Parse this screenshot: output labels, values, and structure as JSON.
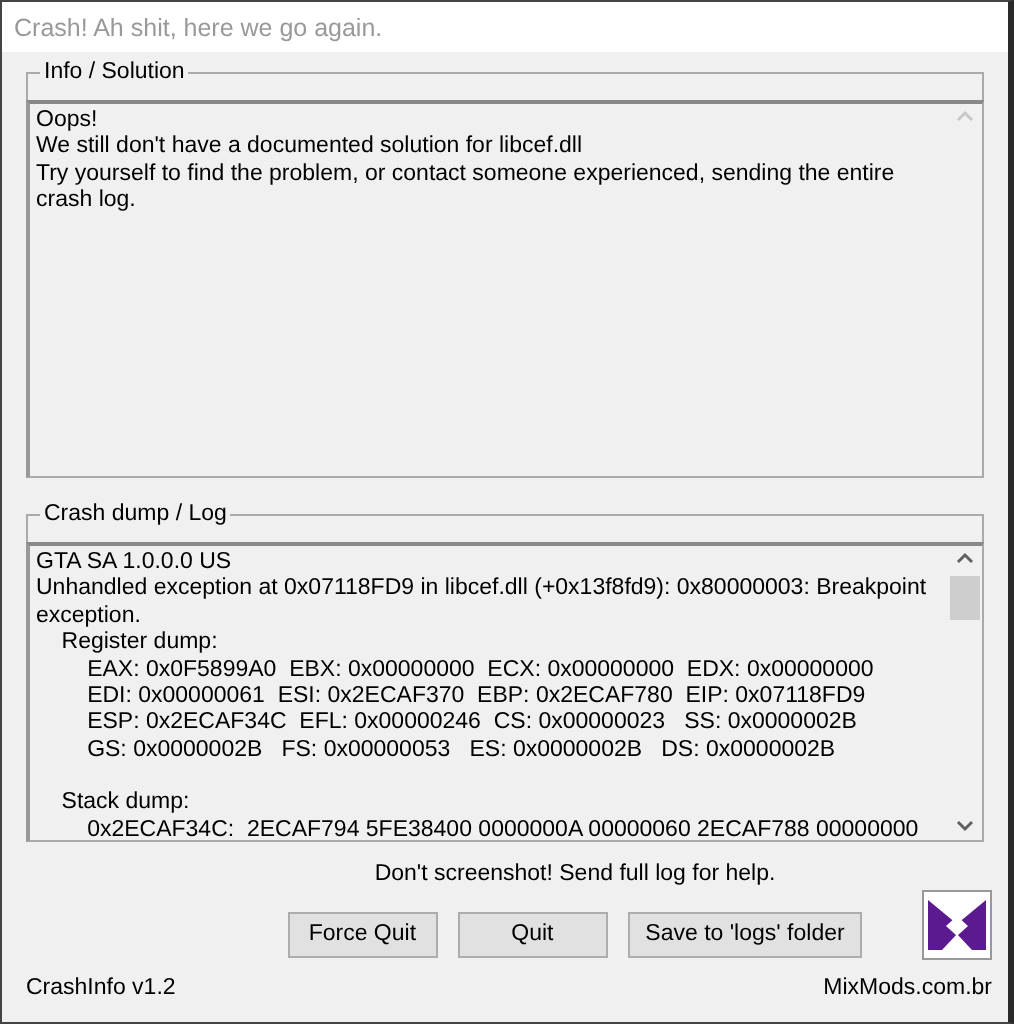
{
  "window": {
    "title": "Crash! Ah shit, here we go again."
  },
  "info": {
    "title": "Info / Solution",
    "lines": [
      "Oops!",
      "We still don't have a documented solution for libcef.dll",
      "Try yourself to find the problem, or contact someone experienced, sending the entire crash log."
    ]
  },
  "log": {
    "title": "Crash dump / Log",
    "sections": [
      {
        "lines": [
          "GTA SA 1.0.0.0 US",
          "Unhandled exception at 0x07118FD9 in libcef.dll (+0x13f8fd9): 0x80000003: Breakpoint exception.",
          "    Register dump:",
          "        EAX: 0x0F5899A0  EBX: 0x00000000  ECX: 0x00000000  EDX: 0x00000000",
          "        EDI: 0x00000061  ESI: 0x2ECAF370  EBP: 0x2ECAF780  EIP: 0x07118FD9",
          "        ESP: 0x2ECAF34C  EFL: 0x00000246  CS: 0x00000023   SS: 0x0000002B",
          "        GS: 0x0000002B   FS: 0x00000053   ES: 0x0000002B   DS: 0x0000002B"
        ]
      },
      {
        "lines": [
          "    Stack dump:",
          "        0x2ECAF34C:  2ECAF794 5FE38400 0000000A 00000060 2ECAF788 00000000"
        ]
      }
    ]
  },
  "notice": "Don't screenshot! Send full log for help.",
  "buttons": [
    "Force Quit",
    "Quit",
    "Save to 'logs' folder"
  ],
  "version": "CrashInfo v1.2",
  "site": "MixMods.com.br"
}
